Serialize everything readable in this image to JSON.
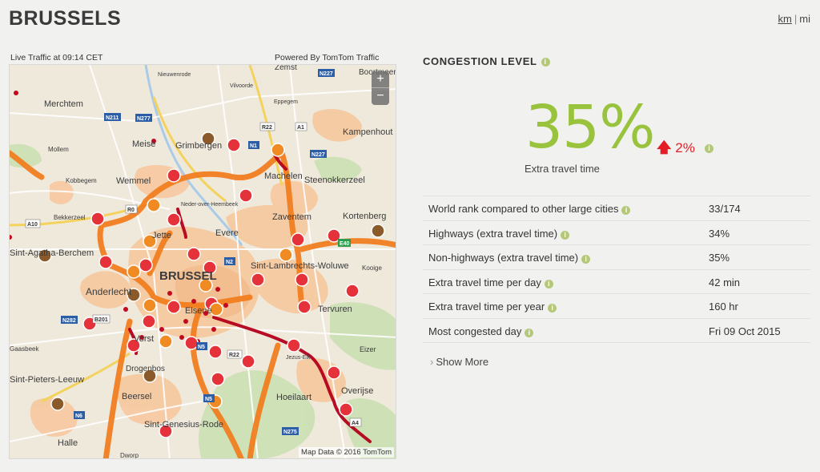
{
  "header": {
    "city": "BRUSSELS",
    "unit_km": "km",
    "unit_sep": "|",
    "unit_mi": "mi"
  },
  "map": {
    "live_label": "Live Traffic at 09:14 CET",
    "powered_by": "Powered By TomTom Traffic",
    "zoom_in": "+",
    "zoom_out": "−",
    "attribution": "Map Data © 2016 TomTom",
    "place_labels": [
      "Merchtem",
      "Meise",
      "Grimbergen",
      "Wemmel",
      "Machelen",
      "Steenokkerzeel",
      "Kampenhout",
      "Zaventem",
      "Kortenberg",
      "Jette",
      "Evere",
      "BRUSSEL",
      "Anderlecht",
      "Elsene",
      "Sint-Lambrechts-Woluwe",
      "Tervuren",
      "Vorst",
      "Drogenbos",
      "Beersel",
      "Sint-Genesius-Rode",
      "Halle",
      "Hoeilaart",
      "Overijse",
      "Sint-Pieters-Leeuw",
      "Kobbegem",
      "Mollem",
      "Bekkerzeel",
      "Boortmeerbeek",
      "Zemst",
      "Eppegem",
      "Nieuwenrode",
      "Sint-Agatha-Berchem",
      "Kooige",
      "Eizer",
      "Gaasbeek",
      "Dworp",
      "Neder-over-Heembeek",
      "Jezus-Eik",
      "Vilvoorde"
    ],
    "road_labels": [
      "N211",
      "N277",
      "R22",
      "A1",
      "N1",
      "N227",
      "R0",
      "A10",
      "N2",
      "N282",
      "B201",
      "N5",
      "N6",
      "N275",
      "A4",
      "E40"
    ]
  },
  "congestion": {
    "title": "CONGESTION LEVEL",
    "value": "35%",
    "change": "2%",
    "change_direction": "up",
    "label": "Extra travel time",
    "accent_color": "#99c23d",
    "change_color": "#e41e26"
  },
  "stats": [
    {
      "label": "World rank compared to other large cities",
      "value": "33/174"
    },
    {
      "label": "Highways (extra travel time)",
      "value": "34%"
    },
    {
      "label": "Non-highways (extra travel time)",
      "value": "35%"
    },
    {
      "label": "Extra travel time per day",
      "value": "42 min"
    },
    {
      "label": "Extra travel time per year",
      "value": "160 hr"
    },
    {
      "label": "Most congested day",
      "value": "Fri 09 Oct 2015"
    }
  ],
  "show_more": "Show More"
}
